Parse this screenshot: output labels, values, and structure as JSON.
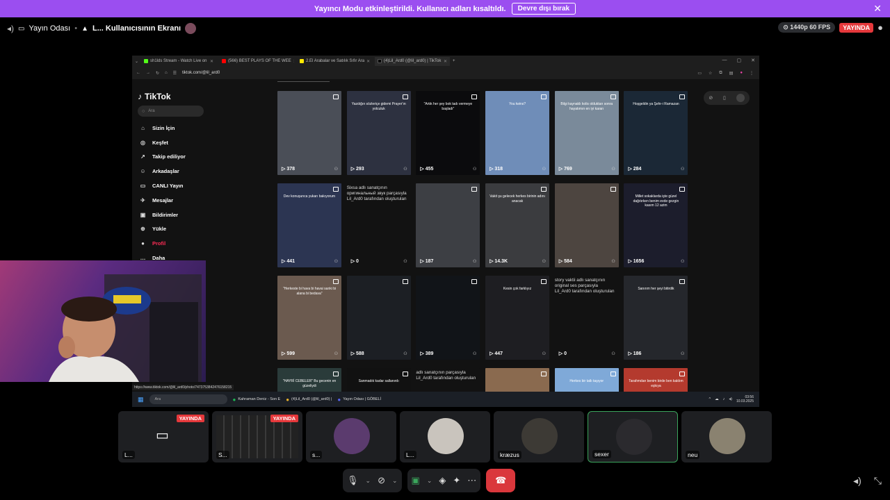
{
  "banner": {
    "text": "Yayıncı Modu etkinleştirildi. Kullanıcı adları kısaltıldı.",
    "button": "Devre dışı bırak"
  },
  "topbar": {
    "channel": "Yayın Odası",
    "screen": "L... Kullanıcısının Ekranı",
    "quality": "1440p 60 FPS",
    "live": "YAYINDA"
  },
  "browser": {
    "tabs": [
      {
        "title": "sh1lds Stream - Watch Live on",
        "color": "#53fc18"
      },
      {
        "title": "(566) BEST PLAYS OF THE WEE",
        "color": "#ff0000"
      },
      {
        "title": "2.El Arabalar ve Satılık Sıfır Ara",
        "color": "#ffe800"
      },
      {
        "title": "(4)Lil_Ard0 (@lil_ard0) | TikTok",
        "color": "#000000"
      }
    ],
    "url": "tiktok.com/@lil_ard0",
    "status_url": "https://www.tiktok.com/@lil_ard0/photo/7473753842476158215"
  },
  "tiktok": {
    "logo": "TikTok",
    "search_placeholder": "Ara",
    "nav": [
      {
        "label": "Sizin İçin",
        "icon": "⌂"
      },
      {
        "label": "Keşfet",
        "icon": "◎"
      },
      {
        "label": "Takip ediliyor",
        "icon": "↗"
      },
      {
        "label": "Arkadaşlar",
        "icon": "☺"
      },
      {
        "label": "CANLI Yayın",
        "icon": "▭"
      },
      {
        "label": "Mesajlar",
        "icon": "✈"
      },
      {
        "label": "Bildirimler",
        "icon": "▣"
      },
      {
        "label": "Yükle",
        "icon": "⊕"
      },
      {
        "label": "Profil",
        "icon": "●"
      },
      {
        "label": "Daha",
        "icon": "…"
      }
    ],
    "videos": [
      {
        "count": "378",
        "caption": "",
        "bg": "#4a4e57"
      },
      {
        "count": "293",
        "caption": "Yazdığın sözleriçe gidemi Prayer'ın yolculuk",
        "bg": "#2d3140"
      },
      {
        "count": "455",
        "caption": "\"Artık her şey bok tadı vermeye başladı\"",
        "bg": "#0b0b0d"
      },
      {
        "count": "318",
        "caption": "You twins?",
        "bg": "#6f8db8"
      },
      {
        "count": "769",
        "caption": "Bilgi kaynaklı kolis olduktan sonra hayatımın en iyi kararı",
        "bg": "#7a8a9a"
      },
      {
        "count": "284",
        "caption": "Hoşgeldin ya Şehr-i Ramazan",
        "bg": "#1b2836"
      },
      {
        "count": "441",
        "caption": "Dev konuşunca yukarı bakıyorum",
        "bg": "#2c3552"
      },
      {
        "count": "0",
        "caption": "Sixsa adlı sanatçının оригинальный звук parçasıyla Lil_Ard0 tarafından oluşturulan",
        "bg": "#121212",
        "broken": true
      },
      {
        "count": "187",
        "caption": "",
        "bg": "#3d3f44"
      },
      {
        "count": "14.3K",
        "caption": "Vakit şu gelecek herkes birinin adını anacak",
        "bg": "#3b3c3f"
      },
      {
        "count": "584",
        "caption": "",
        "bg": "#4d4540"
      },
      {
        "count": "1656",
        "caption": "Millet sokaklarda işte güzel dağıtırken benim evde gezgin kasım 12 azim",
        "bg": "#1c1d2c"
      },
      {
        "count": "599",
        "caption": "\"Herkeste bi hava bi havai sanki bi alana bi bedava\"",
        "bg": "#6b5a4f"
      },
      {
        "count": "588",
        "caption": "",
        "bg": "#1c1f24"
      },
      {
        "count": "389",
        "caption": "",
        "bg": "#111418"
      },
      {
        "count": "447",
        "caption": "Kesin çok farklıyız",
        "bg": "#1e1e22"
      },
      {
        "count": "0",
        "caption": "story vaktii adlı sanatçının original ses parçasıyla Lil_Ard0 tarafından oluşturulan",
        "bg": "#121212",
        "broken": true
      },
      {
        "count": "186",
        "caption": "Sanırım her şeyi bitirdik",
        "bg": "#25272c"
      },
      {
        "count": "",
        "caption": "\"HAYRİ CEBELER\" Bu gecenin en güzeliydi",
        "bg": "#2a3b3a"
      },
      {
        "count": "",
        "caption": "Sanmadık kadar sallanırdı",
        "bg": "#111"
      },
      {
        "count": "",
        "caption": "adlı sanatçının parçasıyla Lil_Ard0 tarafından oluşturulan",
        "bg": "#121212",
        "broken": true
      },
      {
        "count": "",
        "caption": "",
        "bg": "#8a6a4f"
      },
      {
        "count": "",
        "caption": "Herkes bir tatlı taşıyor",
        "bg": "#7fa9d8"
      },
      {
        "count": "",
        "caption": "Tarafımdan benim birde ben kaldım eşkıya",
        "bg": "#b43a2e"
      }
    ]
  },
  "taskbar": {
    "search": "Ara",
    "apps": [
      "Kahraman Deniz - Son E",
      "(4)Lil_Ard0 (@lil_ard0) |",
      "Yayın Odası | GÖBELİ"
    ],
    "time": "03:56",
    "date": "10.03.2025"
  },
  "participants": [
    {
      "name": "L...",
      "live": "YAYINDA",
      "bg": "#141414"
    },
    {
      "name": "S...",
      "live": "YAYINDA",
      "bg": "#0e0e10"
    },
    {
      "name": "s...",
      "live": "",
      "bg": "#5b3b6e"
    },
    {
      "name": "L...",
      "live": "",
      "bg": "#c9c4bd"
    },
    {
      "name": "kræzus",
      "live": "",
      "bg": "#3d3a35"
    },
    {
      "name": "sexer",
      "live": "",
      "bg": "#2b2a2e"
    },
    {
      "name": "neu",
      "live": "",
      "bg": "#8a8270"
    }
  ]
}
